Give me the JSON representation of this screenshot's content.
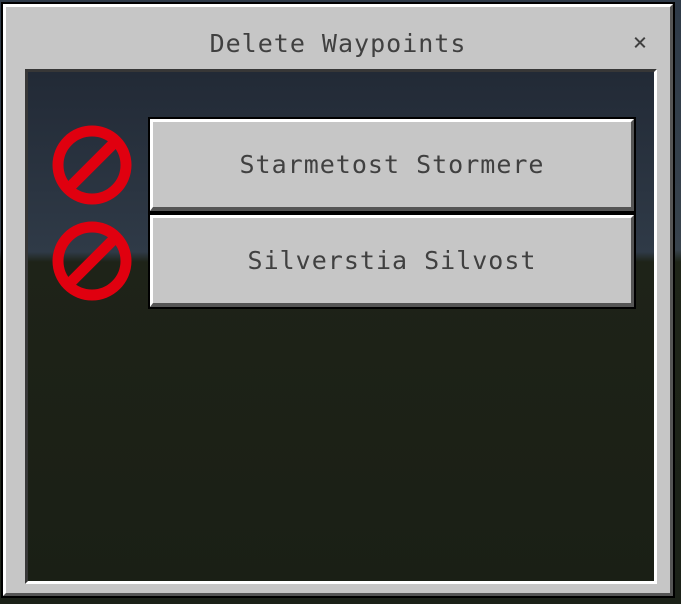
{
  "dialog": {
    "title": "Delete Waypoints",
    "close_label": "×"
  },
  "waypoints": [
    {
      "name": "Starmetost Stormere",
      "delete_icon": "no-entry-icon"
    },
    {
      "name": "Silverstia Silvost",
      "delete_icon": "no-entry-icon"
    }
  ],
  "colors": {
    "panel": "#c6c6c6",
    "text": "#404040",
    "delete_icon": "#e0000f"
  }
}
